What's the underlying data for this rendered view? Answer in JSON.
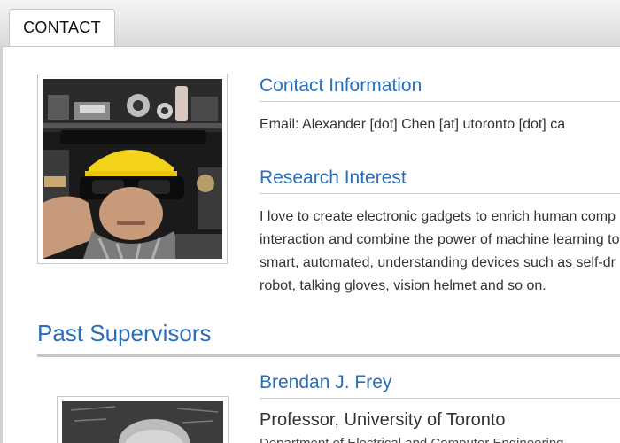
{
  "tab": {
    "label": "CONTACT"
  },
  "contact": {
    "heading": "Contact Information",
    "email_line": "Email: Alexander [dot] Chen [at] utoronto [dot] ca"
  },
  "research": {
    "heading": "Research Interest",
    "lines": [
      "I love to create electronic gadgets to enrich human comp",
      "interaction and combine the power of machine learning to",
      "smart, automated, understanding devices such as self-dr",
      "robot, talking gloves, vision helmet and so on."
    ]
  },
  "past_supervisors": {
    "heading": "Past Supervisors",
    "supervisor": {
      "name": "Brendan J. Frey",
      "title": "Professor, University of Toronto",
      "department": "Department of Electrical and Computer Engineering"
    }
  },
  "colors": {
    "heading_blue": "#2a6ebb",
    "text": "#333333"
  }
}
